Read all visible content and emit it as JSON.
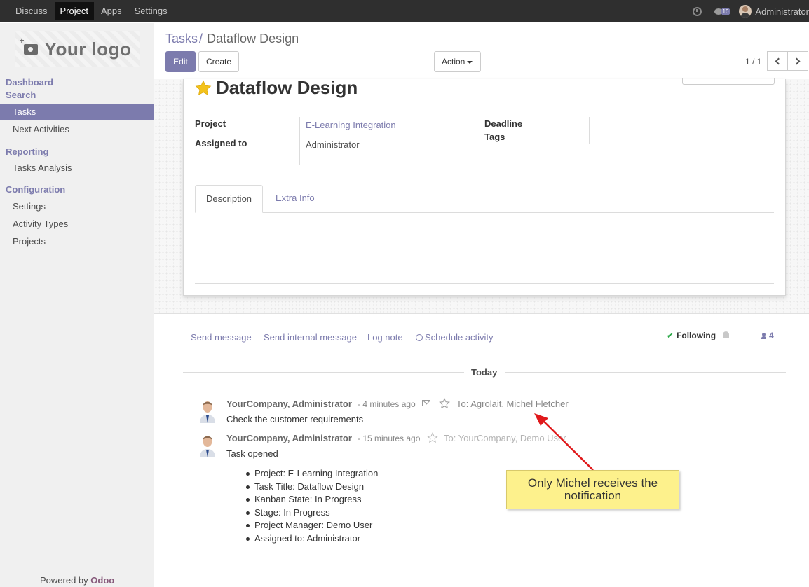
{
  "topbar": {
    "menu": [
      "Discuss",
      "Project",
      "Apps",
      "Settings"
    ],
    "active": "Project",
    "chat_count": "10",
    "user": "Administrator"
  },
  "sidebar": {
    "logo_text": "Your logo",
    "dashboard": "Dashboard",
    "search": "Search",
    "items_main": [
      "Tasks",
      "Next Activities"
    ],
    "reporting": "Reporting",
    "items_reporting": [
      "Tasks Analysis"
    ],
    "configuration": "Configuration",
    "items_config": [
      "Settings",
      "Activity Types",
      "Projects"
    ],
    "powered_by": "Powered by",
    "brand": "Odoo"
  },
  "control_panel": {
    "breadcrumb_parent": "Tasks",
    "breadcrumb_sep": "/",
    "breadcrumb_current": "Dataflow Design",
    "edit": "Edit",
    "create": "Create",
    "action": "Action",
    "pager": "1 / 1"
  },
  "task": {
    "title": "Dataflow Design",
    "project_label": "Project",
    "project_value": "E-Learning Integration",
    "assigned_label": "Assigned to",
    "assigned_value": "Administrator",
    "deadline_label": "Deadline",
    "tags_label": "Tags",
    "tabs": [
      "Description",
      "Extra Info"
    ]
  },
  "chatter": {
    "send_message": "Send message",
    "send_internal": "Send internal message",
    "log_note": "Log note",
    "schedule": "Schedule activity",
    "following": "Following",
    "followers": "4",
    "today": "Today",
    "messages": [
      {
        "author": "YourCompany, Administrator",
        "time": "- 4 minutes ago",
        "to": "To: Agrolait, Michel Fletcher",
        "body": "Check the customer requirements"
      },
      {
        "author": "YourCompany, Administrator",
        "time": "- 15 minutes ago",
        "to": "To: YourCompany, Demo User",
        "body": "Task opened",
        "values": [
          "Project: E-Learning Integration",
          "Task Title: Dataflow Design",
          "Kanban State: In Progress",
          "Stage: In Progress",
          "Project Manager: Demo User",
          "Assigned to: Administrator"
        ]
      }
    ]
  },
  "callout": {
    "text": "Only Michel receives the notification"
  },
  "colors": {
    "primary": "#7c7bad",
    "navbar": "#2f2f2f",
    "star": "#f3c21b",
    "callout": "#fdf18c",
    "arrow": "#e0191b"
  }
}
